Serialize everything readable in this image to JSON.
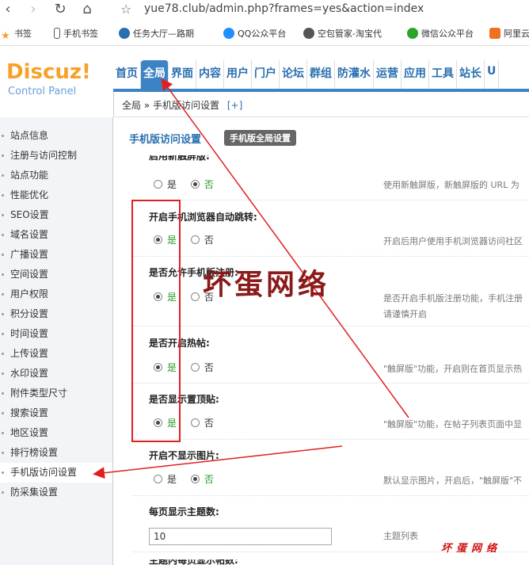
{
  "browser": {
    "url": "yue78.club/admin.php?frames=yes&action=index",
    "bookmarks": [
      "书签",
      "手机书签",
      "任务大厅—路期",
      "QQ公众平台",
      "空包管家-淘宝代",
      "微信公众平台",
      "阿里云"
    ]
  },
  "header": {
    "logo": "Discuz!",
    "logo_sub": "Control Panel",
    "nav": [
      "首页",
      "全局",
      "界面",
      "内容",
      "用户",
      "门户",
      "论坛",
      "群组",
      "防灌水",
      "运营",
      "应用",
      "工具",
      "站长",
      "U"
    ]
  },
  "breadcrumb": {
    "root": "全局",
    "sep": "»",
    "page": "手机版访问设置",
    "plus": "[+]"
  },
  "sidebar": {
    "items": [
      "站点信息",
      "注册与访问控制",
      "站点功能",
      "性能优化",
      "SEO设置",
      "域名设置",
      "广播设置",
      "空间设置",
      "用户权限",
      "积分设置",
      "时间设置",
      "上传设置",
      "水印设置",
      "附件类型尺寸",
      "搜索设置",
      "地区设置",
      "排行榜设置",
      "手机版访问设置",
      "防采集设置"
    ],
    "active_index": 17
  },
  "main": {
    "title": "手机版访问设置",
    "badge": "手机版全局设置",
    "top_label": "启用新触屏版:",
    "settings": [
      {
        "label": "开启手机浏览器自动跳转:",
        "desc": "开启后用户使用手机浏览器访问社区"
      },
      {
        "label": "是否允许手机版注册:",
        "desc": "是否开启手机版注册功能，手机注册",
        "desc2": "请谨慎开启"
      },
      {
        "label": "是否开启热帖:",
        "desc": "\"触屏版\"功能，开启则在首页显示热"
      },
      {
        "label": "是否显示置顶贴:",
        "desc": "\"触屏版\"功能，在帖子列表页面中显"
      },
      {
        "label": "开启不显示图片:",
        "desc": "默认显示图片，开启后，\"触屏版\"不"
      },
      {
        "label": "每页显示主题数:",
        "desc": "主题列表"
      }
    ],
    "top_desc": "使用新触屏版，新触屏版的 URL 为",
    "yes": "是",
    "no": "否",
    "per_page_value": "10",
    "bottom_label": "主题内每页显示帖数:"
  },
  "annotation": {
    "watermark": "坏蛋网络",
    "watermark_small": "坏蛋网络"
  },
  "colors": {
    "accent": "#3b83c4",
    "logo": "#f7a128",
    "annotation": "#e02020"
  }
}
